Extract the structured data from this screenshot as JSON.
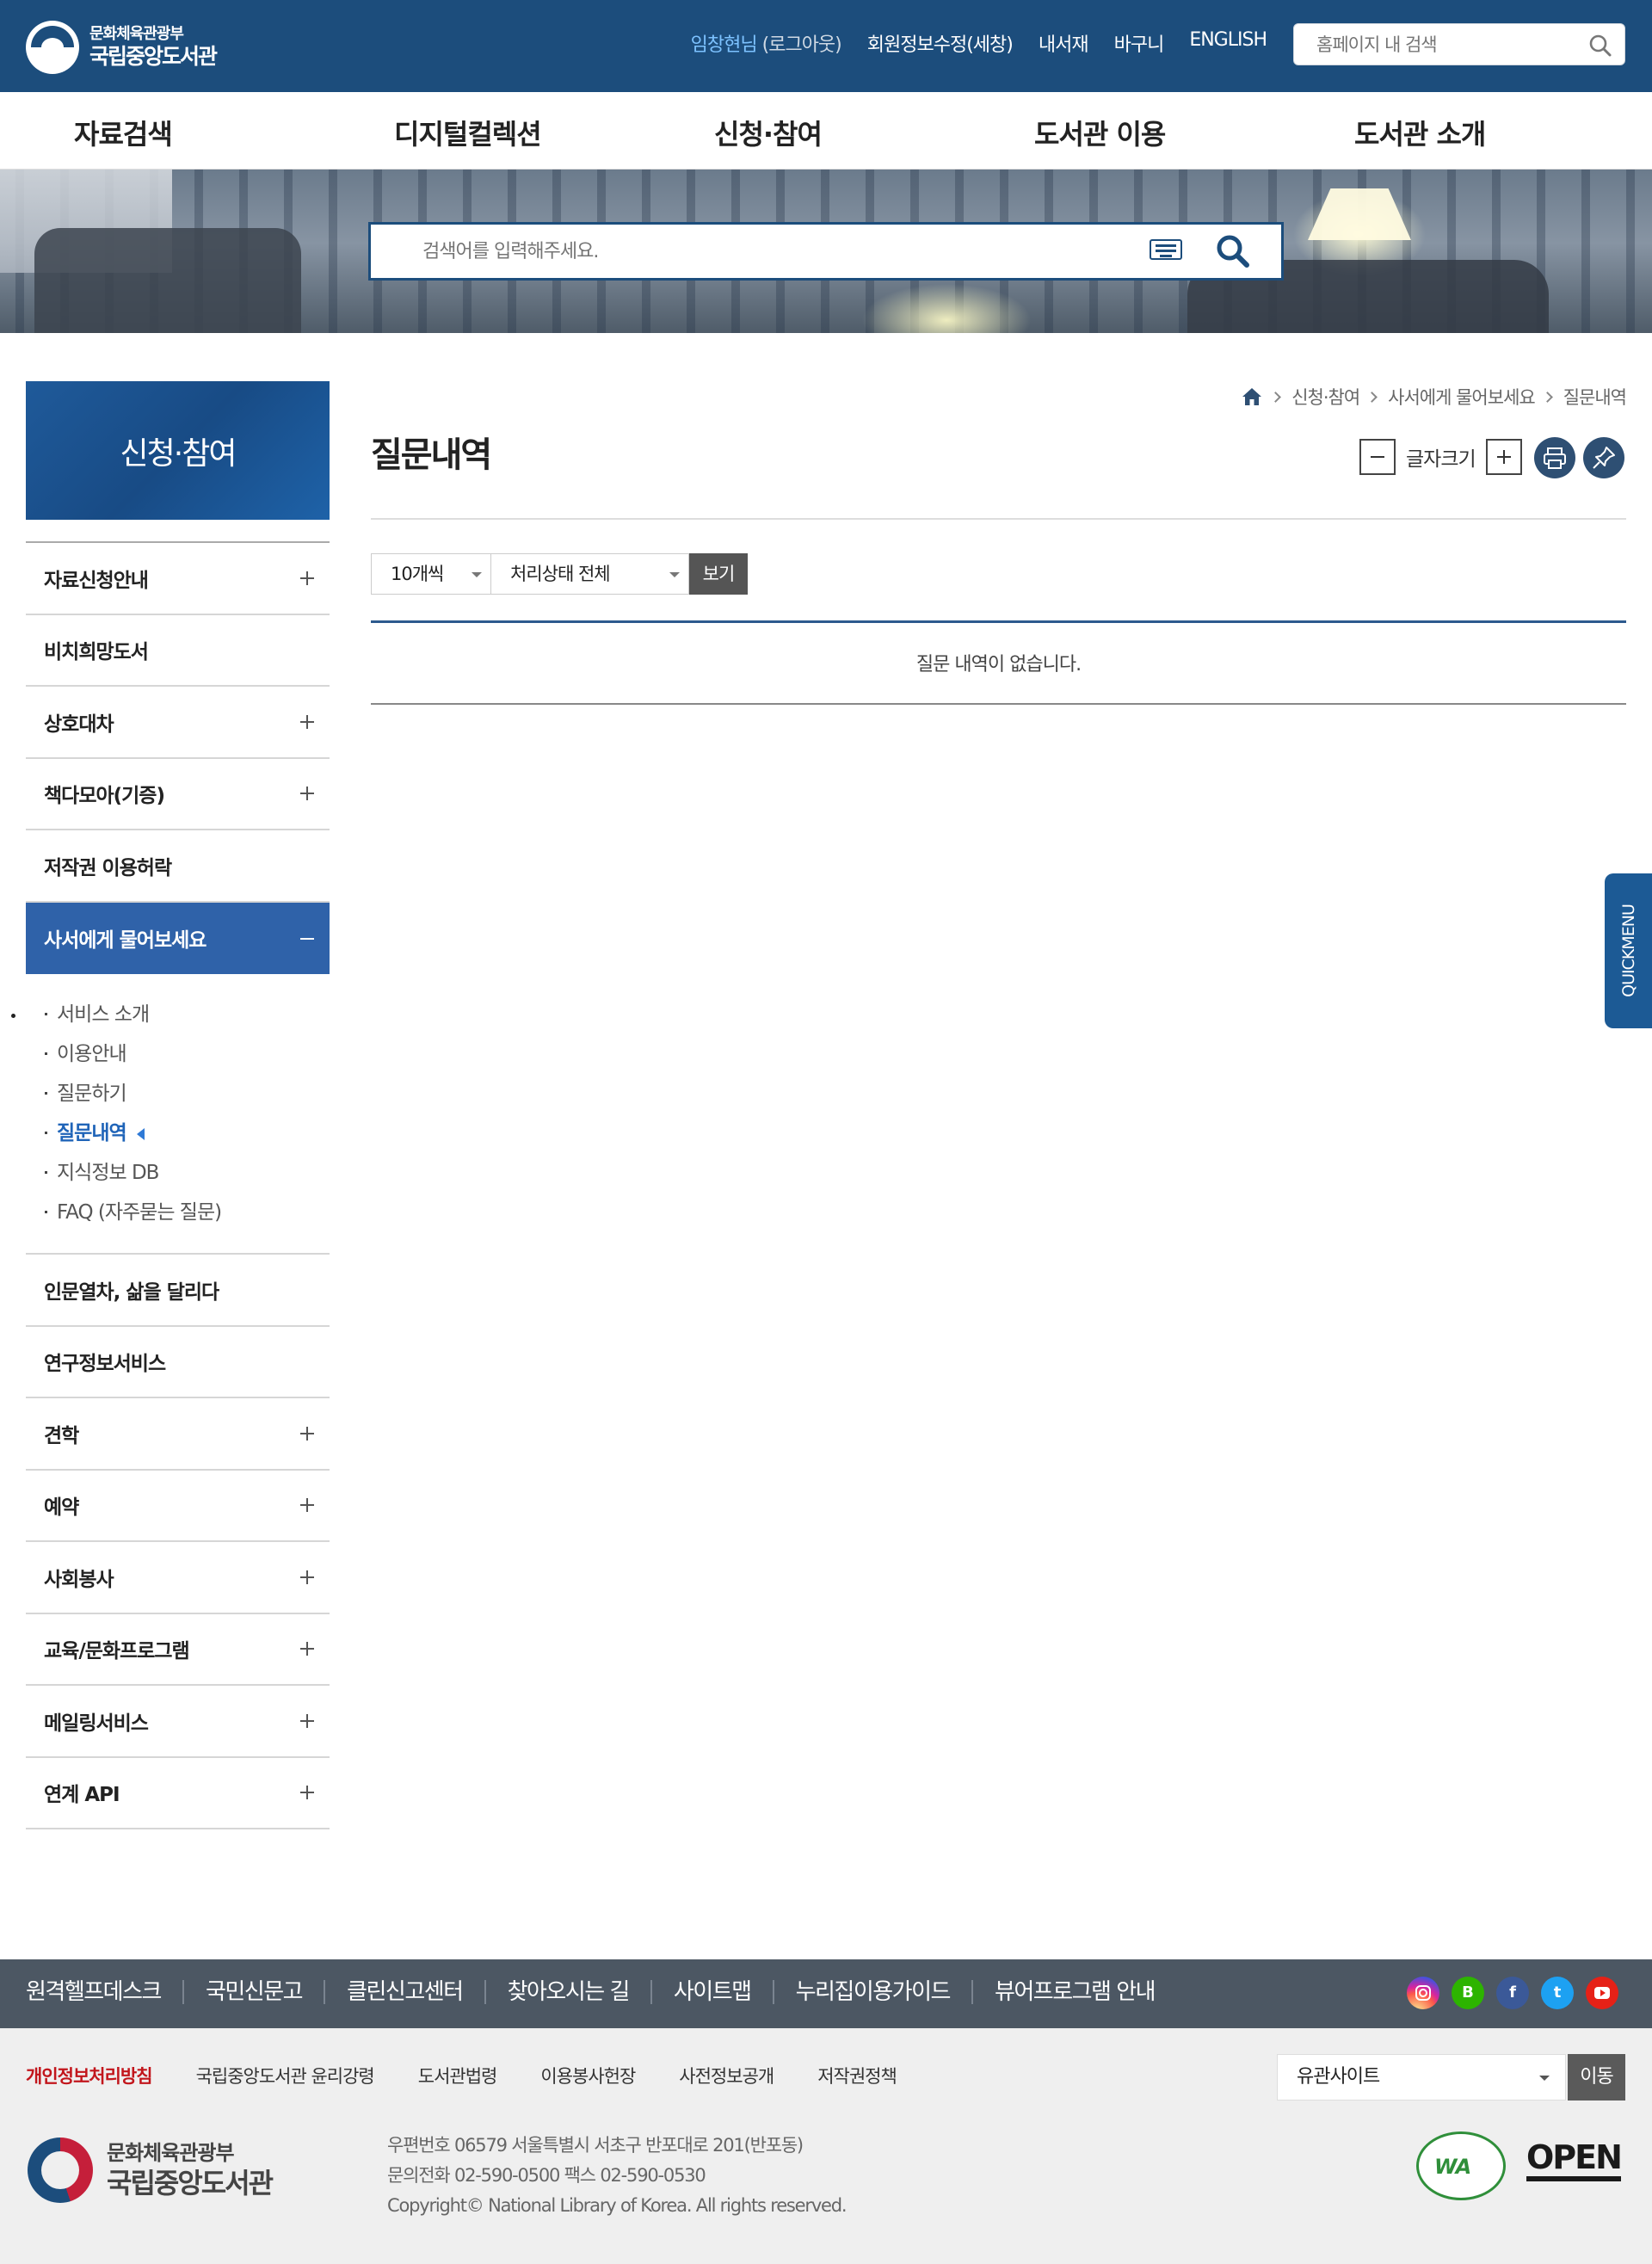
{
  "header": {
    "logo": {
      "line1": "문화체육관광부",
      "line2": "국립중앙도서관"
    },
    "util": {
      "user": "임창현님",
      "logout": "(로그아웃)",
      "member_edit": "회원정보수정(세창)",
      "my_library": "내서재",
      "cart": "바구니",
      "english": "ENGLISH"
    },
    "search": {
      "placeholder": "홈페이지 내 검색",
      "icon": "search-icon"
    }
  },
  "gnb": [
    "자료검색",
    "디지털컬렉션",
    "신청·참여",
    "도서관 이용",
    "도서관 소개"
  ],
  "hero": {
    "search_placeholder": "검색어를 입력해주세요.",
    "keyboard_icon": "keyboard-icon",
    "search_icon": "search-icon"
  },
  "sidebar": {
    "title": "신청·참여",
    "items_top": [
      {
        "label": "자료신청안내",
        "expand": true
      },
      {
        "label": "비치희망도서",
        "expand": false
      },
      {
        "label": "상호대차",
        "expand": true
      },
      {
        "label": "책다모아(기증)",
        "expand": true
      },
      {
        "label": "저작권 이용허락",
        "expand": false
      }
    ],
    "active": {
      "label": "사서에게 물어보세요"
    },
    "sub": [
      "서비스 소개",
      "이용안내",
      "질문하기",
      "질문내역",
      "지식정보 DB",
      "FAQ (자주묻는 질문)"
    ],
    "sub_current": "질문내역",
    "items_bottom": [
      {
        "label": "인문열차, 삶을 달리다",
        "expand": false
      },
      {
        "label": "연구정보서비스",
        "expand": false
      },
      {
        "label": "견학",
        "expand": true
      },
      {
        "label": "예약",
        "expand": true
      },
      {
        "label": "사회봉사",
        "expand": true
      },
      {
        "label": "교육/문화프로그램",
        "expand": true
      },
      {
        "label": "메일링서비스",
        "expand": true
      },
      {
        "label": "연계 API",
        "expand": true
      }
    ]
  },
  "content": {
    "breadcrumb": [
      "신청·참여",
      "사서에게 물어보세요",
      "질문내역"
    ],
    "title": "질문내역",
    "font_size_label": "글자크기",
    "filters": {
      "per_page": "10개씩",
      "status": "처리상태 전체",
      "view_button": "보기"
    },
    "empty_message": "질문 내역이 없습니다."
  },
  "quick_menu": "QUICKMENU",
  "footer": {
    "links": [
      "원격헬프데스크",
      "국민신문고",
      "클린신고센터",
      "찾아오시는 길",
      "사이트맵",
      "누리집이용가이드",
      "뷰어프로그램 안내"
    ],
    "sns": [
      "instagram-icon",
      "blog-icon",
      "facebook-icon",
      "twitter-icon",
      "youtube-icon"
    ],
    "sns_colors": [
      "#d6249f",
      "#2db400",
      "#3b5998",
      "#1da1f2",
      "#e62117"
    ],
    "policy": [
      "개인정보처리방침",
      "국립중앙도서관 윤리강령",
      "도서관법령",
      "이용봉사헌장",
      "사전정보공개",
      "저작권정책"
    ],
    "site_select": "유관사이트",
    "go_button": "이동",
    "logo": {
      "line1": "문화체육관광부",
      "line2": "국립중앙도서관"
    },
    "address": "우편번호 06579 서울특별시 서초구 반포대로 201(반포동)",
    "phone": "문의전화 02-590-0500 팩스 02-590-0530",
    "copyright": "Copyright© National Library of Korea. All rights reserved.",
    "badges": {
      "wa": "WA",
      "open": "OPEN"
    }
  }
}
